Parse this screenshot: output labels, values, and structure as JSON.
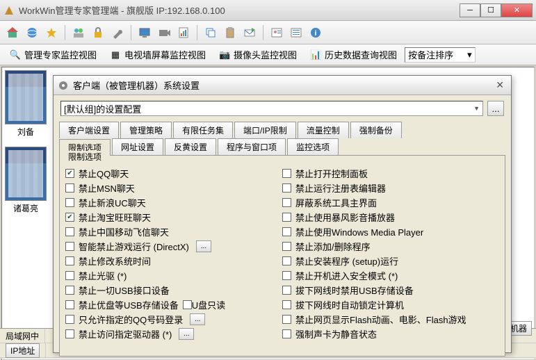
{
  "app": {
    "title": "WorkWin管理专家管理端 - 旗舰版 IP:192.168.0.100"
  },
  "viewbar": {
    "v1": "管理专家监控视图",
    "v2": "电视墙屏幕监控视图",
    "v3": "摄像头监控视图",
    "v4": "历史数据查询视图",
    "sort_label": "按备注排序"
  },
  "thumbs": {
    "t1": "刘备",
    "t2": "诸葛亮"
  },
  "bottom": {
    "lan": "局域网中",
    "ip": "IP地址",
    "monitor": "监视机器"
  },
  "dialog": {
    "title": "客户端（被管理机器）系统设置",
    "dropdown": "[默认组]的设置配置",
    "tabs_row1": [
      "客户端设置",
      "管理策略",
      "有限任务集",
      "端口/IP限制",
      "流量控制",
      "强制备份"
    ],
    "tabs_row2": [
      "限制选项",
      "网址设置",
      "反黄设置",
      "程序与窗口项",
      "监控选项"
    ],
    "groupbox_title": "限制选项",
    "left": [
      {
        "label": "禁止QQ聊天",
        "c": true
      },
      {
        "label": "禁止MSN聊天",
        "c": false
      },
      {
        "label": "禁止新浪UC聊天",
        "c": false
      },
      {
        "label": "禁止淘宝旺旺聊天",
        "c": true
      },
      {
        "label": "禁止中国移动飞信聊天",
        "c": false
      },
      {
        "label": "智能禁止游戏运行 (DirectX)",
        "c": false,
        "btn": true
      },
      {
        "label": "禁止修改系统时间",
        "c": false
      },
      {
        "label": "禁止光驱 (*)",
        "c": false
      },
      {
        "label": "禁止一切USB接口设备",
        "c": false
      },
      {
        "label": "禁止优盘等USB存储设备",
        "c": false,
        "extra": "U盘只读"
      },
      {
        "label": "只允许指定的QQ号码登录",
        "c": false,
        "btn": true
      },
      {
        "label": "禁止访问指定驱动器 (*)",
        "c": false,
        "btn": true
      }
    ],
    "right": [
      {
        "label": "禁止打开控制面板",
        "c": false
      },
      {
        "label": "禁止运行注册表编辑器",
        "c": false
      },
      {
        "label": "屏蔽系统工具主界面",
        "c": false
      },
      {
        "label": "禁止使用暴风影音播放器",
        "c": false
      },
      {
        "label": "禁止使用Windows Media Player",
        "c": false
      },
      {
        "label": "禁止添加/删除程序",
        "c": false
      },
      {
        "label": "禁止安装程序 (setup)运行",
        "c": false
      },
      {
        "label": "禁止开机进入安全模式 (*)",
        "c": false
      },
      {
        "label": "拔下网线时禁用USB存储设备",
        "c": false
      },
      {
        "label": "拔下网线时自动锁定计算机",
        "c": false
      },
      {
        "label": "禁止网页显示Flash动画、电影、Flash游戏",
        "c": false
      },
      {
        "label": "强制声卡为静音状态",
        "c": false
      }
    ]
  }
}
